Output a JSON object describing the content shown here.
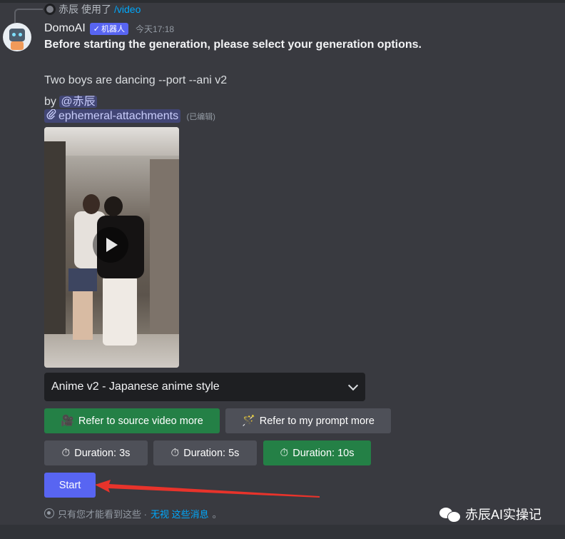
{
  "reply": {
    "user": "赤辰",
    "action": "使用了",
    "command": "/video"
  },
  "message": {
    "username": "DomoAI",
    "bot_tag": "机器人",
    "timestamp": "今天17:18",
    "heading": "Before starting the generation, please select your generation options.",
    "prompt": "Two boys are dancing --port --ani v2",
    "by_label": "by",
    "mention": "@赤辰",
    "attachment": "ephemeral-attachments",
    "edited": "(已编辑)"
  },
  "video": {
    "state": "paused"
  },
  "select": {
    "value": "Anime v2 - Japanese anime style"
  },
  "buttons": {
    "refer_source": "Refer to source video more",
    "refer_prompt": "Refer to my prompt more",
    "duration_3": "Duration: 3s",
    "duration_5": "Duration: 5s",
    "duration_10": "Duration: 10s",
    "start": "Start"
  },
  "ephemeral": {
    "note": "只有您才能看到这些 · ",
    "dismiss": "无视 这些消息",
    "end": "。"
  },
  "watermark": {
    "text": "赤辰AI实操记"
  },
  "colors": {
    "green": "#248046",
    "grey": "#4e5058",
    "blurple": "#5865f2",
    "background": "#393a40",
    "arrow": "#e8332b"
  },
  "icons": {
    "reply_avatar": "user-avatar-icon",
    "bot_tag": "checkmark-icon",
    "attachment": "paperclip-icon",
    "refer_source": "video-camera-icon",
    "refer_prompt": "magic-wand-icon",
    "duration": "stopwatch-icon",
    "ephemeral": "eye-icon",
    "watermark": "wechat-icon"
  }
}
